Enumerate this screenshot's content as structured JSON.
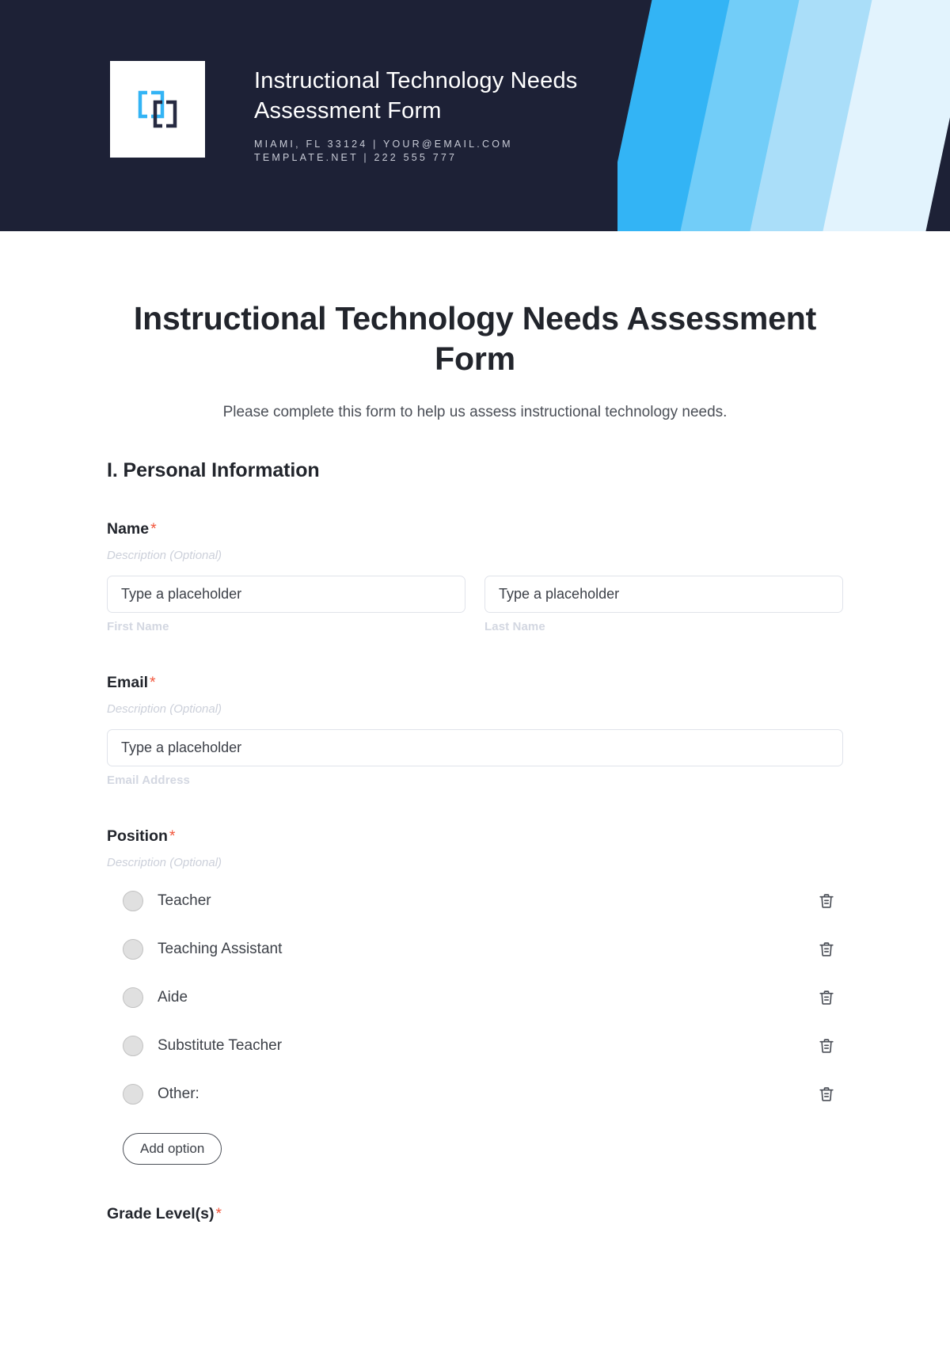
{
  "header": {
    "company_name": "Instructional Technology Needs\nAssessment Form",
    "contact_line_1": "MIAMI, FL 33124 | YOUR@EMAIL.COM",
    "contact_line_2": "TEMPLATE.NET | 222 555 777",
    "logo_icon": "bracket-frames-logo",
    "colors": {
      "header_bg": "#1d2136",
      "stripe_1": "#33b4f5",
      "stripe_2": "#72cdf8",
      "stripe_3": "#aadef9",
      "stripe_4": "#e2f3fd",
      "logo_blue": "#33b4f5",
      "logo_navy": "#262a41"
    }
  },
  "form": {
    "title": "Instructional Technology Needs Assessment Form",
    "subtitle": "Please complete this form to help us assess instructional technology needs.",
    "required_marker": "*",
    "sections": [
      {
        "heading": "I. Personal Information",
        "fields": [
          {
            "label": "Name",
            "required": true,
            "description": "Description (Optional)",
            "type": "name",
            "inputs": [
              {
                "placeholder": "Type a placeholder",
                "value": "",
                "sub_label": "First Name"
              },
              {
                "placeholder": "Type a placeholder",
                "value": "",
                "sub_label": "Last Name"
              }
            ]
          },
          {
            "label": "Email",
            "required": true,
            "description": "Description (Optional)",
            "type": "email",
            "inputs": [
              {
                "placeholder": "Type a placeholder",
                "value": "",
                "sub_label": "Email Address"
              }
            ]
          },
          {
            "label": "Position",
            "required": true,
            "description": "Description (Optional)",
            "type": "radio",
            "options": [
              {
                "label": "Teacher",
                "selected": false,
                "delete_icon": "trash-icon"
              },
              {
                "label": "Teaching Assistant",
                "selected": false,
                "delete_icon": "trash-icon"
              },
              {
                "label": "Aide",
                "selected": false,
                "delete_icon": "trash-icon"
              },
              {
                "label": "Substitute Teacher",
                "selected": false,
                "delete_icon": "trash-icon"
              },
              {
                "label": "Other:",
                "selected": false,
                "delete_icon": "trash-icon"
              }
            ],
            "add_option_label": "Add option"
          },
          {
            "label": "Grade Level(s)",
            "required": true,
            "type": "partial"
          }
        ]
      }
    ]
  }
}
